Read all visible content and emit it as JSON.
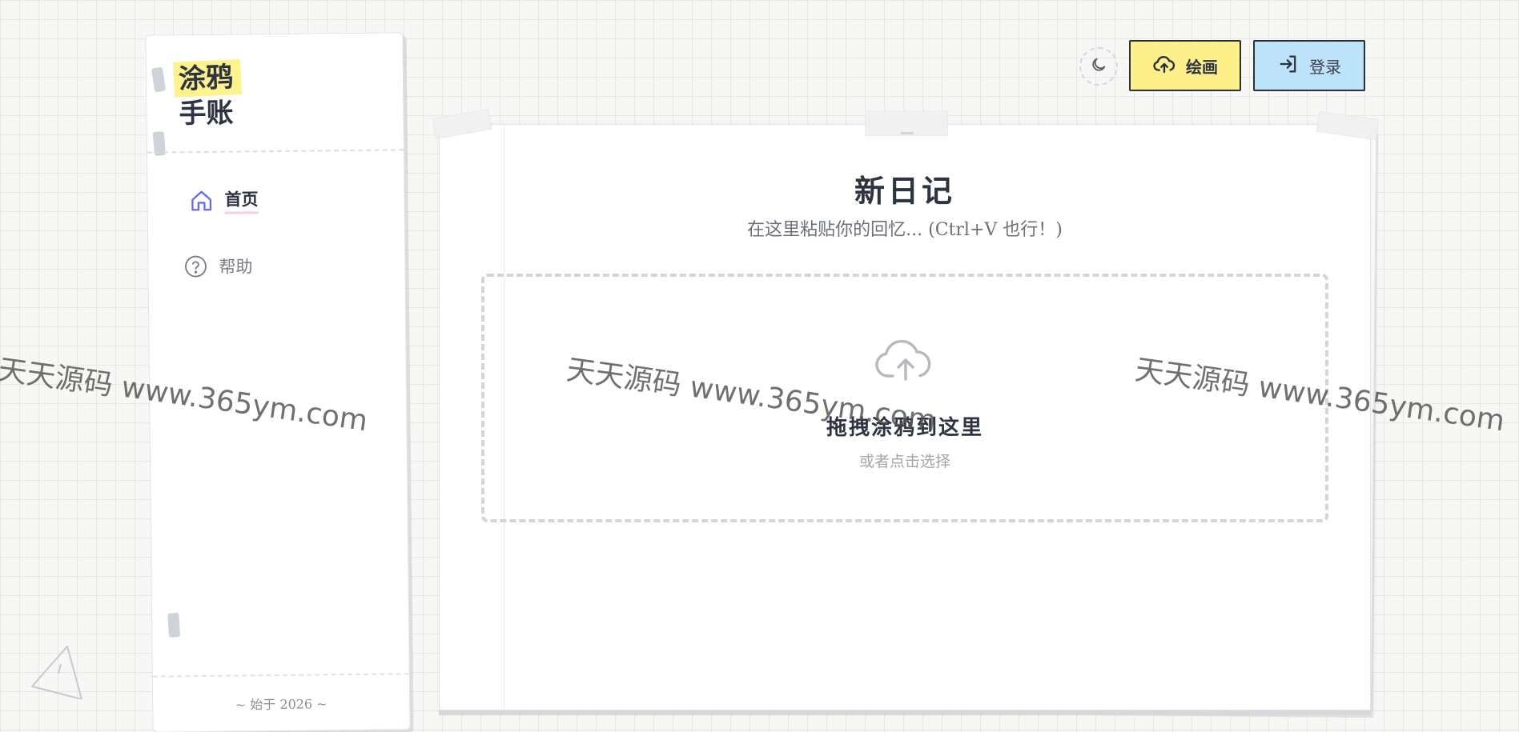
{
  "sidebar": {
    "logo_line1": "涂鸦",
    "logo_line2": "手账",
    "nav": [
      {
        "label": "首页",
        "icon": "home-icon",
        "active": true
      },
      {
        "label": "帮助",
        "icon": "help-circle-icon",
        "active": false
      }
    ],
    "footer": "~ 始于 2026 ~"
  },
  "header": {
    "theme_icon": "moon-icon",
    "draw_button": {
      "label": "绘画",
      "icon": "cloud-upload-icon",
      "color": "#fdf08a"
    },
    "login_button": {
      "label": "登录",
      "icon": "login-arrow-icon",
      "color": "#bde3fb"
    }
  },
  "main": {
    "title": "新日记",
    "subtitle": "在这里粘贴你的回忆... (Ctrl+V 也行！)",
    "dropzone": {
      "icon": "cloud-upload-icon",
      "title": "拖拽涂鸦到这里",
      "subtitle": "或者点击选择"
    }
  },
  "watermark": "天天源码 www.365ym.com",
  "colors": {
    "highlight_yellow": "#fdf28b",
    "accent_indigo": "#6366f1",
    "text_dark": "#2d3340"
  }
}
